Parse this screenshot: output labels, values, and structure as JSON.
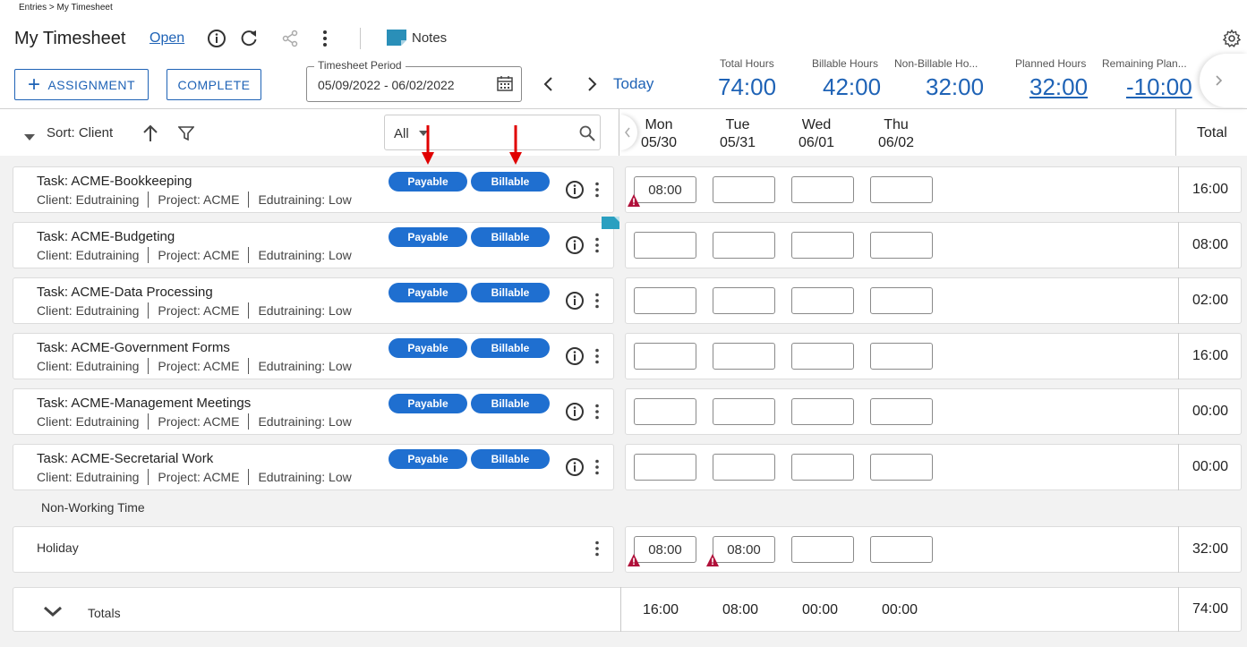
{
  "breadcrumb": "Entries > My Timesheet",
  "header": {
    "title": "My Timesheet",
    "status": "Open",
    "notes_label": "Notes"
  },
  "toolbar": {
    "assignment_label": "ASSIGNMENT",
    "complete_label": "COMPLETE",
    "period_label": "Timesheet Period",
    "period_value": "05/09/2022 - 06/02/2022",
    "today_label": "Today"
  },
  "stats": [
    {
      "label": "Total Hours",
      "value": "74:00"
    },
    {
      "label": "Billable Hours",
      "value": "42:00"
    },
    {
      "label": "Non-Billable Ho...",
      "value": "32:00"
    },
    {
      "label": "Planned Hours",
      "value": "32:00"
    },
    {
      "label": "Remaining Plan...",
      "value": "-10:00"
    }
  ],
  "list_controls": {
    "sort_label": "Sort: Client",
    "filter_value": "All"
  },
  "days": [
    {
      "dow": "Mon",
      "date": "05/30"
    },
    {
      "dow": "Tue",
      "date": "05/31"
    },
    {
      "dow": "Wed",
      "date": "06/01"
    },
    {
      "dow": "Thu",
      "date": "06/02"
    }
  ],
  "total_header": "Total",
  "tasks": [
    {
      "title": "Task: ACME-Bookkeeping",
      "client": "Client: Edutraining",
      "project": "Project: ACME",
      "level": "Edutraining: Low",
      "payable": "Payable",
      "billable": "Billable",
      "hours": [
        "08:00",
        "",
        "",
        ""
      ],
      "total": "16:00"
    },
    {
      "title": "Task: ACME-Budgeting",
      "client": "Client: Edutraining",
      "project": "Project: ACME",
      "level": "Edutraining: Low",
      "payable": "Payable",
      "billable": "Billable",
      "hours": [
        "",
        "",
        "",
        ""
      ],
      "total": "08:00"
    },
    {
      "title": "Task: ACME-Data Processing",
      "client": "Client: Edutraining",
      "project": "Project: ACME",
      "level": "Edutraining: Low",
      "payable": "Payable",
      "billable": "Billable",
      "hours": [
        "",
        "",
        "",
        ""
      ],
      "total": "02:00"
    },
    {
      "title": "Task: ACME-Government Forms",
      "client": "Client: Edutraining",
      "project": "Project: ACME",
      "level": "Edutraining: Low",
      "payable": "Payable",
      "billable": "Billable",
      "hours": [
        "",
        "",
        "",
        ""
      ],
      "total": "16:00"
    },
    {
      "title": "Task: ACME-Management Meetings",
      "client": "Client: Edutraining",
      "project": "Project: ACME",
      "level": "Edutraining: Low",
      "payable": "Payable",
      "billable": "Billable",
      "hours": [
        "",
        "",
        "",
        ""
      ],
      "total": "00:00"
    },
    {
      "title": "Task: ACME-Secretarial Work",
      "client": "Client: Edutraining",
      "project": "Project: ACME",
      "level": "Edutraining: Low",
      "payable": "Payable",
      "billable": "Billable",
      "hours": [
        "",
        "",
        "",
        ""
      ],
      "total": "00:00"
    }
  ],
  "non_working": {
    "section_label": "Non-Working Time",
    "row_label": "Holiday",
    "hours": [
      "08:00",
      "08:00",
      "",
      ""
    ],
    "total": "32:00"
  },
  "totals": {
    "label": "Totals",
    "days": [
      "16:00",
      "08:00",
      "00:00",
      "00:00"
    ],
    "grand": "74:00"
  },
  "colors": {
    "accent": "#1f63b6",
    "pill": "#1f6fd0",
    "warning": "#b0103a",
    "annotation_arrow": "#e00000"
  }
}
